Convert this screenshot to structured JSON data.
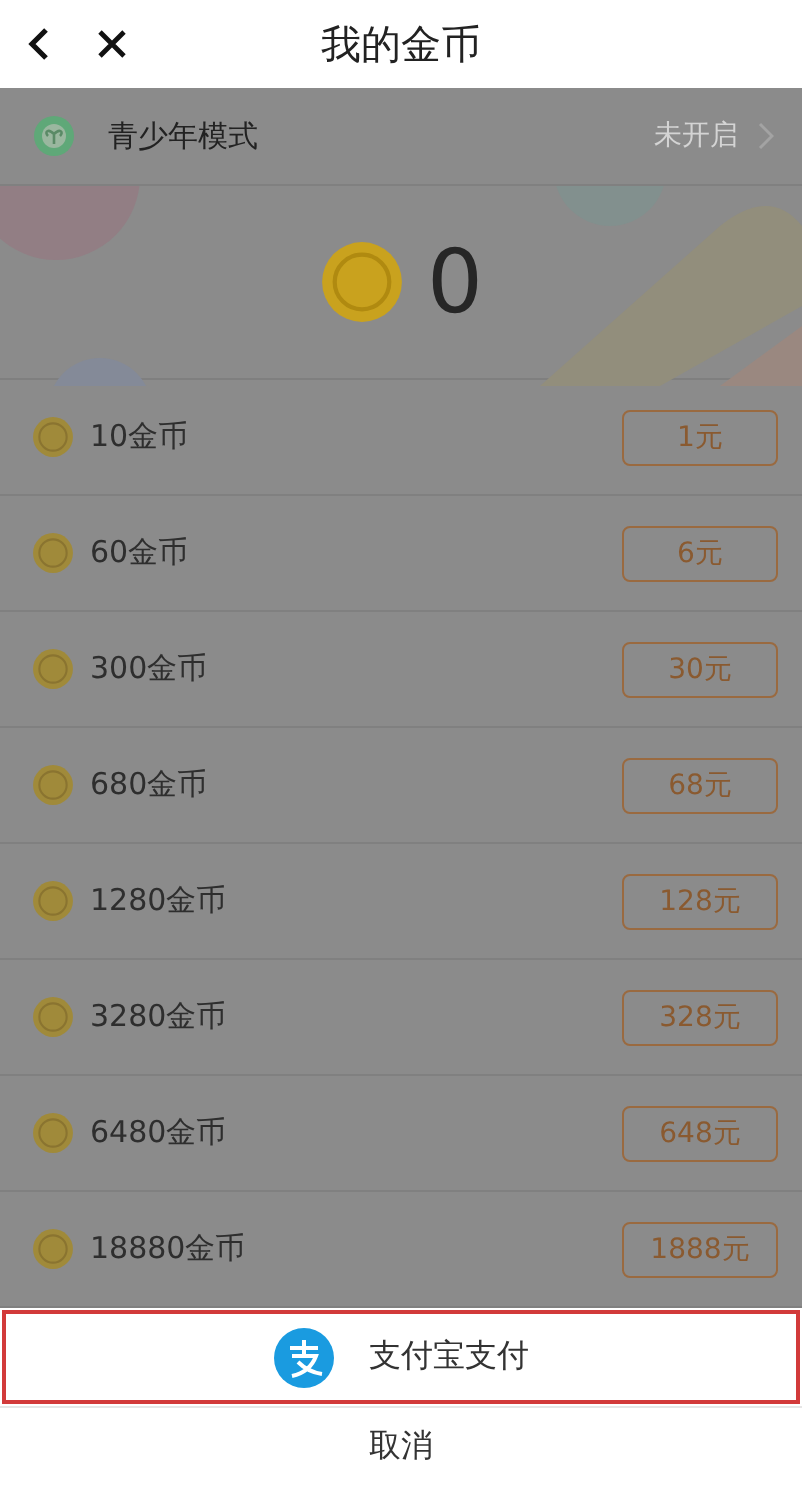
{
  "header": {
    "title": "我的金币"
  },
  "youth_mode": {
    "label": "青少年模式",
    "status": "未开启"
  },
  "balance": {
    "amount": "0"
  },
  "packages": [
    {
      "coins": "10金币",
      "price": "1元"
    },
    {
      "coins": "60金币",
      "price": "6元"
    },
    {
      "coins": "300金币",
      "price": "30元"
    },
    {
      "coins": "680金币",
      "price": "68元"
    },
    {
      "coins": "1280金币",
      "price": "128元"
    },
    {
      "coins": "3280金币",
      "price": "328元"
    },
    {
      "coins": "6480金币",
      "price": "648元"
    },
    {
      "coins": "18880金币",
      "price": "1888元"
    }
  ],
  "payment_sheet": {
    "options": [
      {
        "label": "支付宝支付",
        "highlighted": true
      }
    ],
    "cancel": "取消"
  }
}
